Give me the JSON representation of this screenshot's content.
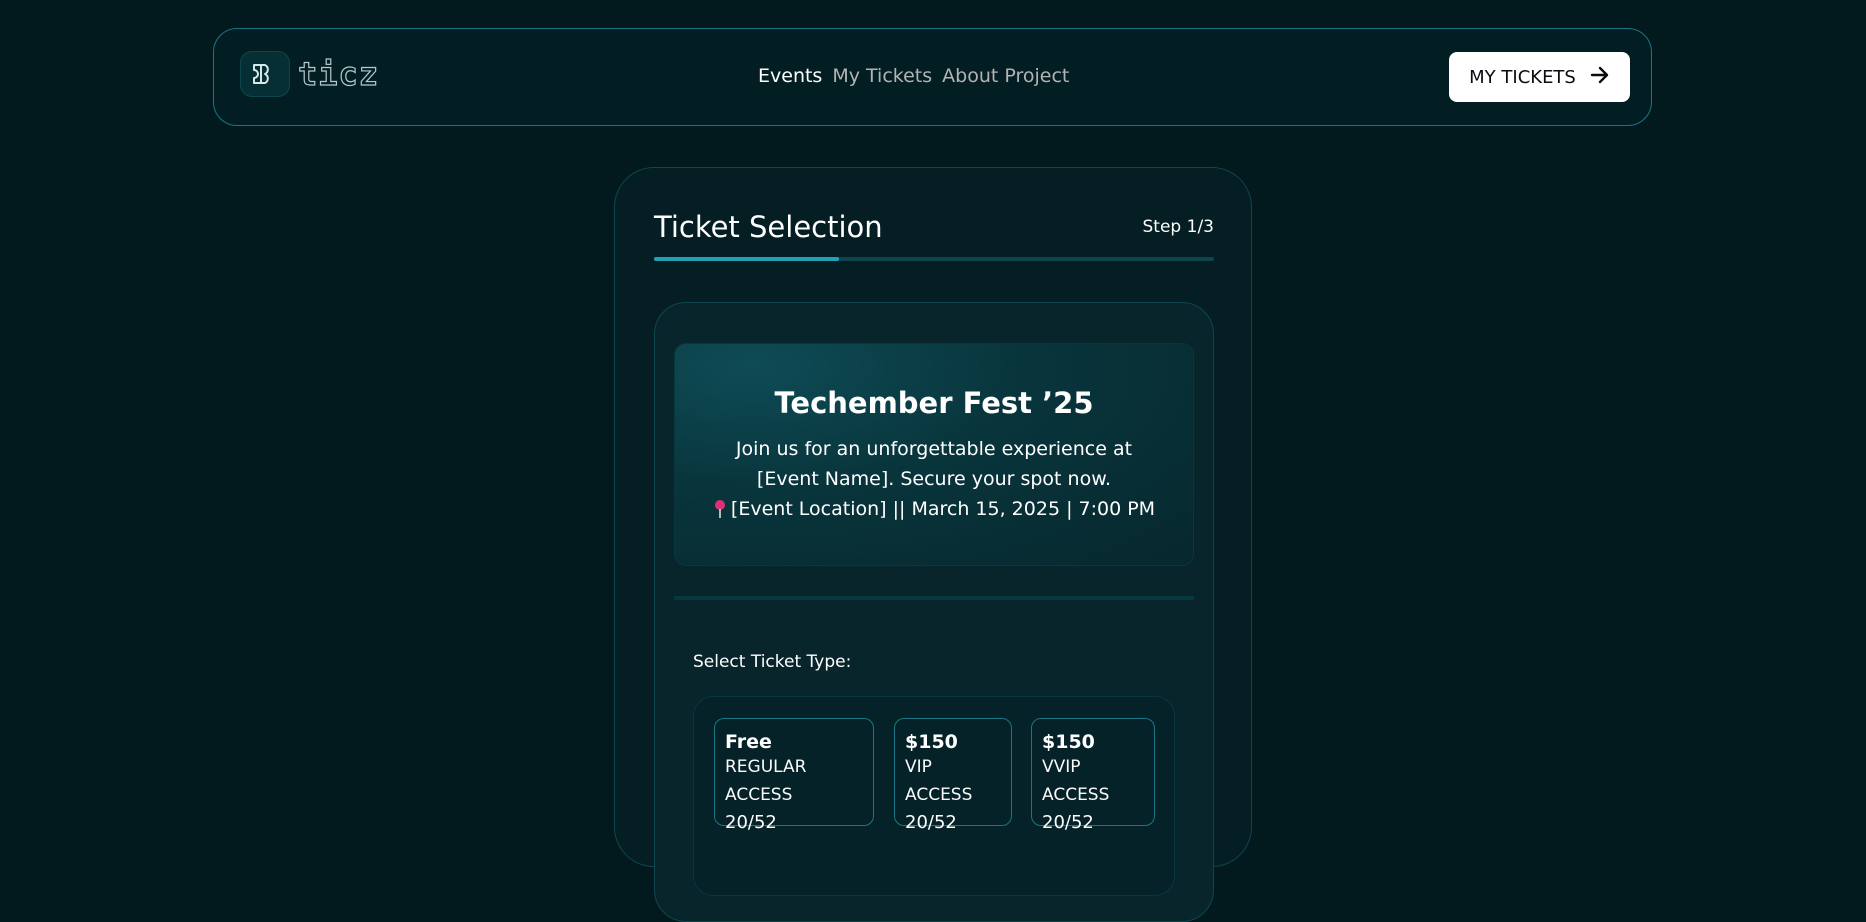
{
  "brand": {
    "name": "ticz",
    "colors": {
      "background": "#02191d",
      "accent": "#24a0b5",
      "border": "#197686"
    }
  },
  "nav": {
    "links": [
      {
        "label": "Events",
        "active": true
      },
      {
        "label": "My Tickets",
        "active": false
      },
      {
        "label": "About Project",
        "active": false
      }
    ],
    "cta_label": "MY TICKETS",
    "cta_icon": "arrow-right-icon"
  },
  "card": {
    "title": "Ticket Selection",
    "step": "Step 1/3",
    "progress": 0.33
  },
  "event": {
    "title": "Techember Fest ’25",
    "description": "Join us for an unforgettable experience at [Event Name]. Secure your spot now.",
    "pin_icon": "location-pin-icon",
    "meta": "[Event Location] || March 15, 2025 | 7:00 PM"
  },
  "ticket_section": {
    "label": "Select Ticket Type:",
    "options": [
      {
        "price": "Free",
        "name": "REGULAR ACCESS",
        "count": "20/52"
      },
      {
        "price": "$150",
        "name": "VIP ACCESS",
        "count": "20/52"
      },
      {
        "price": "$150",
        "name": "VVIP ACCESS",
        "count": "20/52"
      }
    ]
  }
}
